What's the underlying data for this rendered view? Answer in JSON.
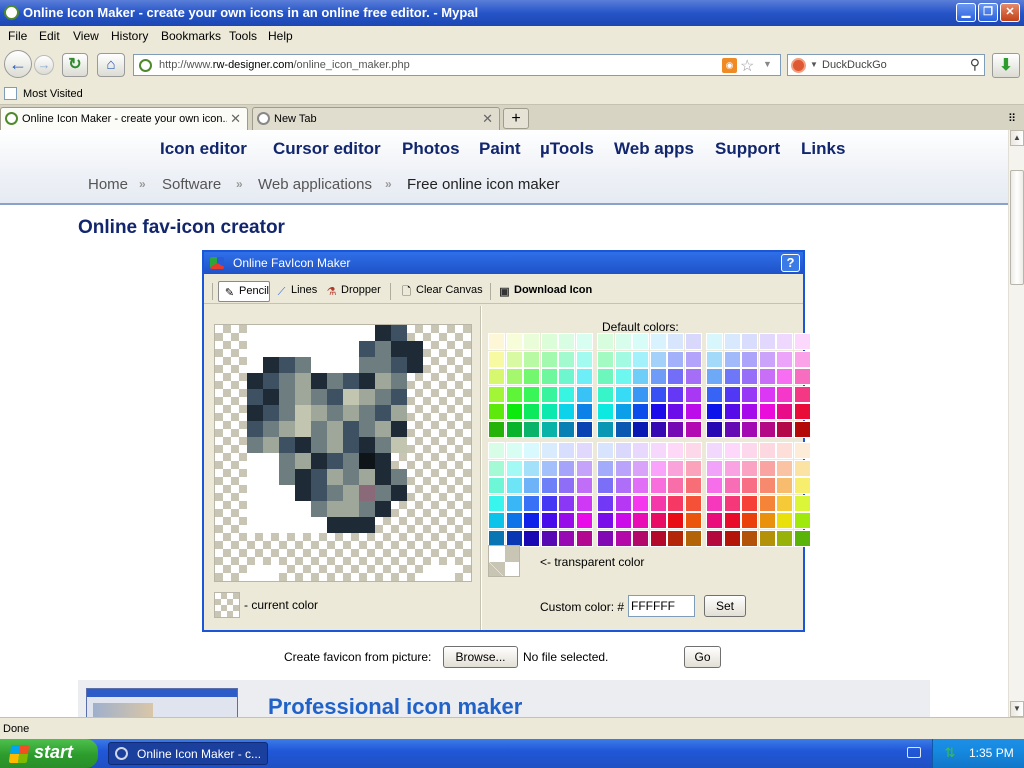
{
  "window": {
    "title": "Online Icon Maker - create your own icons in an online free editor. - Mypal"
  },
  "menu": [
    "File",
    "Edit",
    "View",
    "History",
    "Bookmarks",
    "Tools",
    "Help"
  ],
  "nav": {
    "url_prefix": "http://www.",
    "url_domain": "rw-designer.com",
    "url_path": "/online_icon_maker.php",
    "search_placeholder": "DuckDuckGo"
  },
  "bookmarks": {
    "most_visited": "Most Visited"
  },
  "tabs": [
    {
      "title": "Online Icon Maker - create your own icon...",
      "active": true
    },
    {
      "title": "New Tab",
      "active": false
    }
  ],
  "site_nav": [
    "Icon editor",
    "Cursor editor",
    "Photos",
    "Paint",
    "µTools",
    "Web apps",
    "Support",
    "Links"
  ],
  "breadcrumb": [
    "Home",
    "Software",
    "Web applications",
    "Free online icon maker"
  ],
  "page_title": "Online fav-icon creator",
  "editor": {
    "title": "Online FavIcon Maker",
    "tools": [
      "Pencil",
      "Lines",
      "Dropper",
      "Clear Canvas",
      "Download Icon"
    ],
    "selected_tool": "Pencil",
    "current_color_label": "- current color",
    "default_colors_label": "Default colors:",
    "transparent_label": "<- transparent color",
    "custom_color_label": "Custom color: #",
    "custom_color_value": "FFFFFF",
    "set_label": "Set"
  },
  "favicon_upload": {
    "label": "Create favicon from picture:",
    "browse": "Browse...",
    "file_status": "No file selected.",
    "go": "Go"
  },
  "promo": {
    "title": "Professional icon maker"
  },
  "status": {
    "text": "Done"
  },
  "taskbar": {
    "start": "start",
    "item": "Online Icon Maker - c...",
    "clock": "1:35 PM"
  },
  "colors": {
    "accent": "#1c56d8",
    "site_nav": "#12266e",
    "promo_title": "#2162c8"
  }
}
